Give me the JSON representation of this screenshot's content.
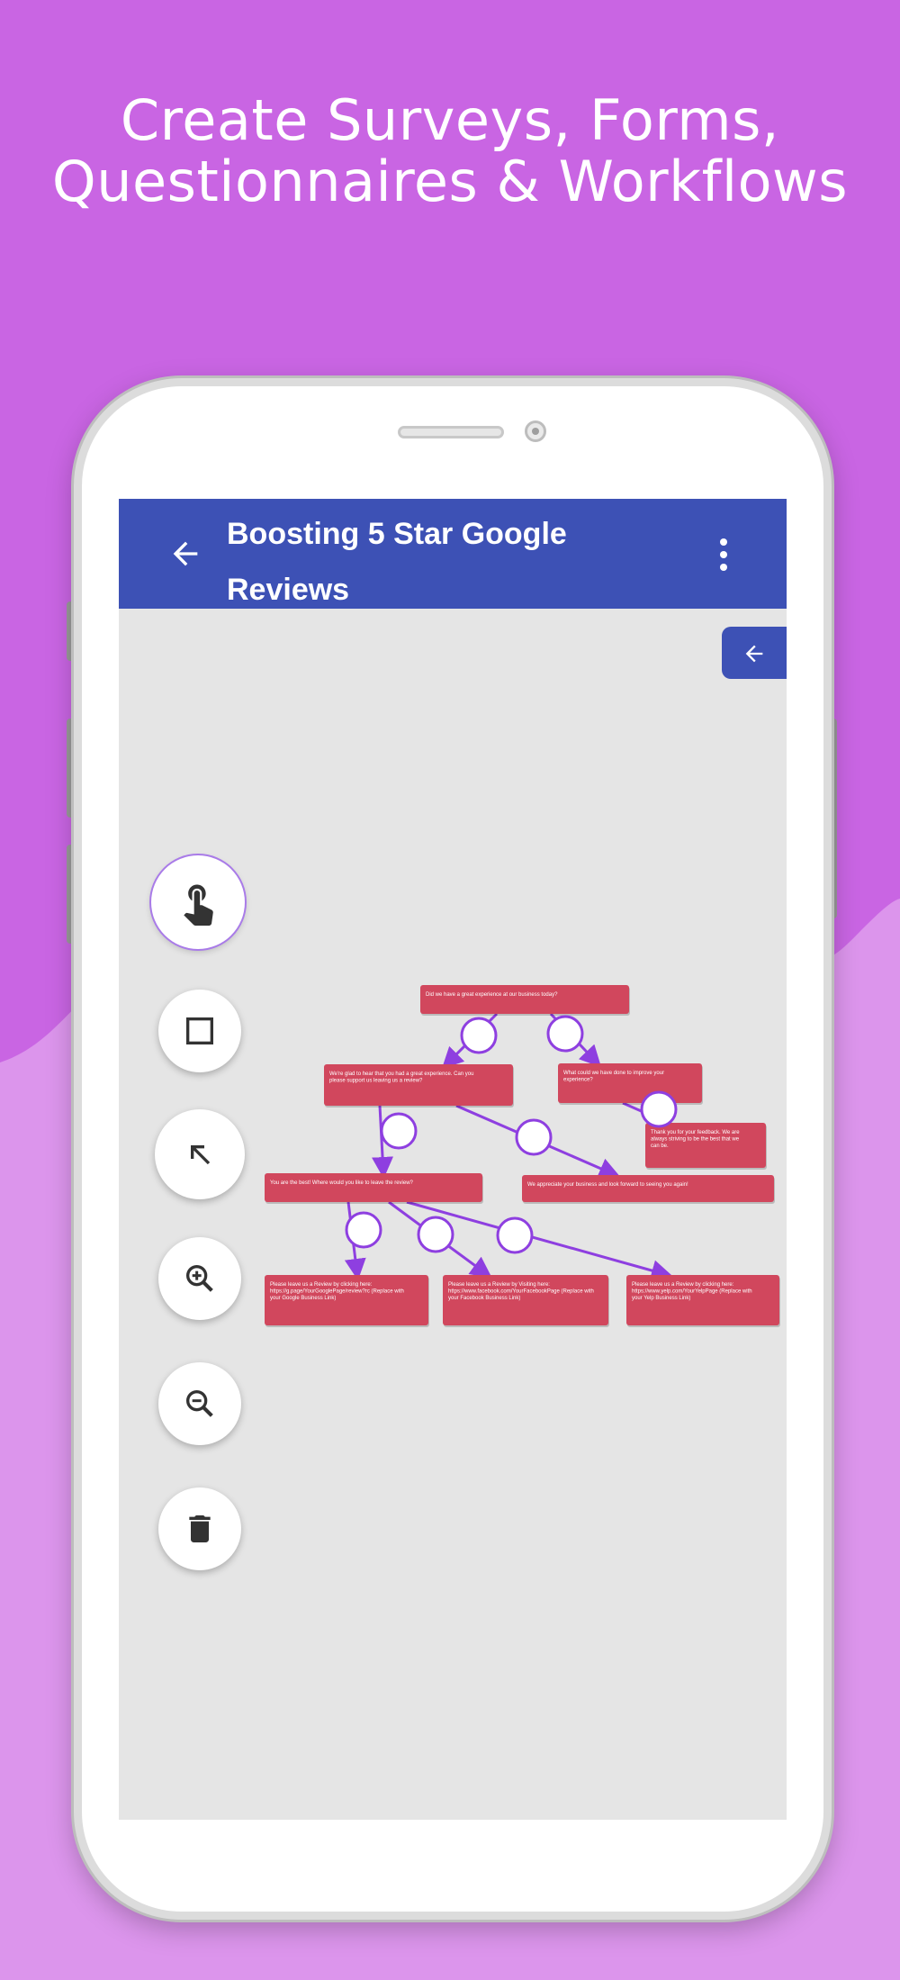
{
  "headline": {
    "line1": "Create Surveys, Forms,",
    "line2": "Questionnaires & Workflows"
  },
  "appbar": {
    "back_icon": "arrow-left-icon",
    "title_line1": "Boosting 5 Star Google",
    "title_line2": "Reviews",
    "menu_icon": "more-vertical-icon"
  },
  "panel_toggle_icon": "arrow-left-icon",
  "tools": [
    {
      "icon": "hand-pointer-icon",
      "active": true
    },
    {
      "icon": "square-icon",
      "active": false
    },
    {
      "icon": "arrow-up-left-icon",
      "active": false
    },
    {
      "icon": "zoom-in-icon",
      "active": false
    },
    {
      "icon": "zoom-out-icon",
      "active": false
    },
    {
      "icon": "trash-icon",
      "active": false
    }
  ],
  "flow": {
    "node_color": "#d1475d",
    "edge_color": "#8e3fe0",
    "nodes": [
      {
        "id": "q1",
        "text": "Did we have a great experience at our business today?"
      },
      {
        "id": "yes",
        "text": "We're glad to hear that you had a great experience. Can you please support us leaving us a review?"
      },
      {
        "id": "improve",
        "text": "What could we have done to improve your experience?"
      },
      {
        "id": "thanks",
        "text": "Thank you for your feedback. We are always striving to be the best that we can be."
      },
      {
        "id": "where",
        "text": "You are the best! Where would you like to leave the review?"
      },
      {
        "id": "appreciate",
        "text": "We appreciate your business and look forward to seeing you again!"
      },
      {
        "id": "google",
        "text": "Please leave us a Review by clicking here: https://g.page/YourGooglePage/review?rc (Replace with your Google Business Link)"
      },
      {
        "id": "facebook",
        "text": "Please leave us a Review by Visiting here: https://www.facebook.com/YourFacebookPage (Replace with your Facebook Business Link)"
      },
      {
        "id": "yelp",
        "text": "Please leave us a Review by clicking here: https://www.yelp.com/YourYelpPage (Replace with your Yelp Business Link)"
      }
    ]
  }
}
